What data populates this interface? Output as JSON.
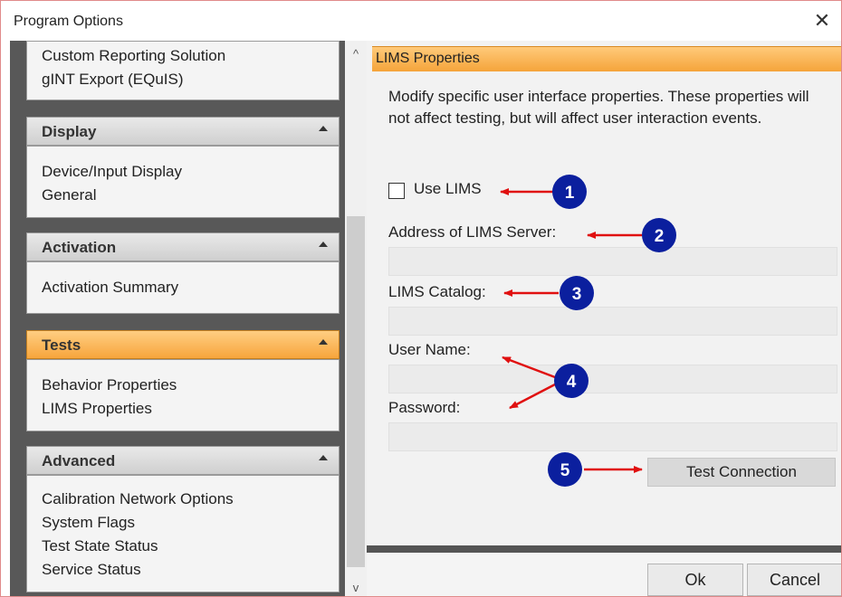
{
  "window": {
    "title": "Program Options",
    "close_glyph": "✕"
  },
  "nav": {
    "top_items": [
      "Custom Reporting Solution",
      "gINT Export (EQuIS)"
    ],
    "groups": [
      {
        "title": "Display",
        "items": [
          "Device/Input Display",
          "General"
        ]
      },
      {
        "title": "Activation",
        "items": [
          "Activation Summary"
        ]
      },
      {
        "title": "Tests",
        "items": [
          "Behavior Properties",
          "LIMS Properties"
        ],
        "active": true
      },
      {
        "title": "Advanced",
        "items": [
          "Calibration Network Options",
          "System Flags",
          "Test State Status",
          "Service Status"
        ]
      }
    ]
  },
  "scrollbar": {
    "up_glyph": "^",
    "down_glyph": "v"
  },
  "properties": {
    "header": "LIMS Properties",
    "description": "Modify specific user interface properties.   These properties will not affect testing, but will affect user interaction events.",
    "use_lims_label": "Use LIMS",
    "use_lims_checked": false,
    "address_label": "Address of LIMS Server:",
    "address_value": "",
    "catalog_label": "LIMS Catalog:",
    "catalog_value": "",
    "username_label": "User Name:",
    "username_value": "",
    "password_label": "Password:",
    "password_value": "",
    "test_connection_label": "Test Connection"
  },
  "footer": {
    "ok_label": "Ok",
    "cancel_label": "Cancel"
  },
  "callouts": [
    "1",
    "2",
    "3",
    "4",
    "5"
  ],
  "colors": {
    "accent_orange": "#f5a43a",
    "callout_blue": "#0b1f9e",
    "arrow_red": "#e01010"
  }
}
